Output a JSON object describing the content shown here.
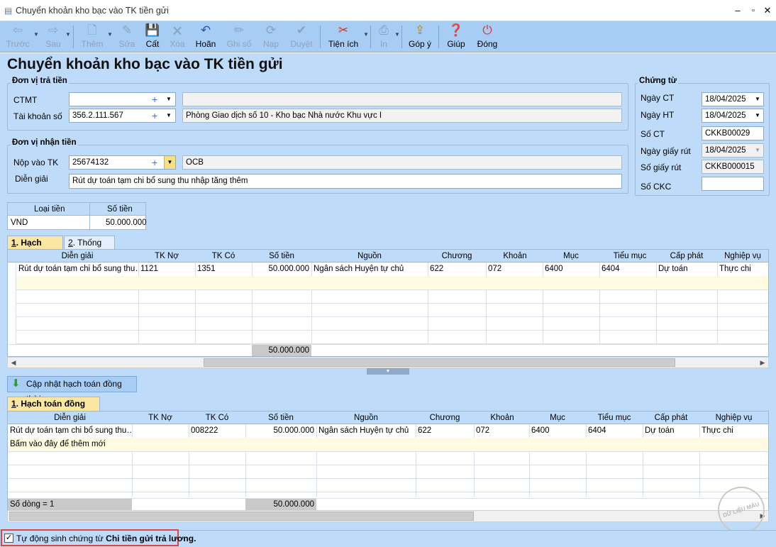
{
  "window": {
    "title": "Chuyển khoản kho bạc vào TK tiền gửi"
  },
  "toolbar": {
    "prev": "Trước",
    "next": "Sau",
    "add": "Thêm",
    "edit": "Sửa",
    "save": "Cất",
    "delete": "Xóa",
    "undo": "Hoãn",
    "post": "Ghi sổ",
    "load": "Nạp",
    "approve": "Duyệt",
    "utilities": "Tiện ích",
    "print": "In",
    "feedback": "Góp ý",
    "help": "Giúp",
    "close": "Đóng"
  },
  "page_title": "Chuyển khoản kho bạc vào TK tiền gửi",
  "payer": {
    "group_title": "Đơn vị trả tiền",
    "ctmt_label": "CTMT",
    "ctmt_value": "",
    "ctmt_desc": "",
    "account_label": "Tài khoản số",
    "account_value": "356.2.111.567",
    "account_desc": "Phòng Giao dịch số 10 - Kho bạc Nhà nước Khu vực I"
  },
  "receiver": {
    "group_title": "Đơn vị nhận tiền",
    "deposit_label": "Nộp vào TK",
    "deposit_value": "25674132",
    "deposit_desc": "OCB",
    "note_label": "Diễn giải",
    "note_value": "Rút dự toán tạm chi bổ sung thu nhập tăng thêm"
  },
  "voucher": {
    "group_title": "Chứng từ",
    "date_ct_label": "Ngày CT",
    "date_ct": "18/04/2025",
    "date_ht_label": "Ngày HT",
    "date_ht": "18/04/2025",
    "no_ct_label": "Số CT",
    "no_ct": "CKKB00029",
    "date_withdraw_label": "Ngày giấy rút",
    "date_withdraw": "18/04/2025",
    "no_withdraw_label": "Số giấy rút",
    "no_withdraw": "CKKB000015",
    "no_ckc_label": "Số CKC",
    "no_ckc": ""
  },
  "currency": {
    "col_type": "Loại tiền",
    "col_amount": "Số tiền",
    "type": "VND",
    "amount": "50.000.000"
  },
  "tabs": {
    "accounting": "Hạch toán",
    "accounting_num": "1",
    "stats": "Thống kê",
    "stats_num": "2"
  },
  "grid1": {
    "columns": [
      "Diễn giải",
      "TK Nợ",
      "TK Có",
      "Số tiền",
      "Nguồn",
      "Chương",
      "Khoản",
      "Mục",
      "Tiểu mục",
      "Cấp phát",
      "Nghiệp vụ"
    ],
    "row": [
      "Rút dự toán tạm chi bổ sung thu…",
      "1121",
      "1351",
      "50.000.000",
      "Ngân sách Huyện tự chủ",
      "622",
      "072",
      "6400",
      "6404",
      "Dự toán",
      "Thực chi"
    ],
    "total": "50.000.000"
  },
  "update_button": "Cập nhật hạch toán đồng thời",
  "tab2": {
    "num": "1",
    "label": "Hạch toán đồng thời"
  },
  "grid2": {
    "columns": [
      "Diễn giải",
      "TK Nợ",
      "TK Có",
      "Số tiền",
      "Nguồn",
      "Chương",
      "Khoản",
      "Mục",
      "Tiểu mục",
      "Cấp phát",
      "Nghiệp vụ"
    ],
    "row": [
      "Rút dự toán tạm chi bổ sung thu…",
      "",
      "008222",
      "50.000.000",
      "Ngân sách Huyện tự chủ",
      "622",
      "072",
      "6400",
      "6404",
      "Dự toán",
      "Thực chi"
    ],
    "add_hint": "Bấm vào đây để thêm mới",
    "row_count": "Số dòng = 1",
    "total": "50.000.000"
  },
  "status": {
    "prefix": "Tự động sinh chứng từ ",
    "bold": "Chi tiền gửi trả lương."
  },
  "watermark": "DỮ LIỆU MẪU"
}
